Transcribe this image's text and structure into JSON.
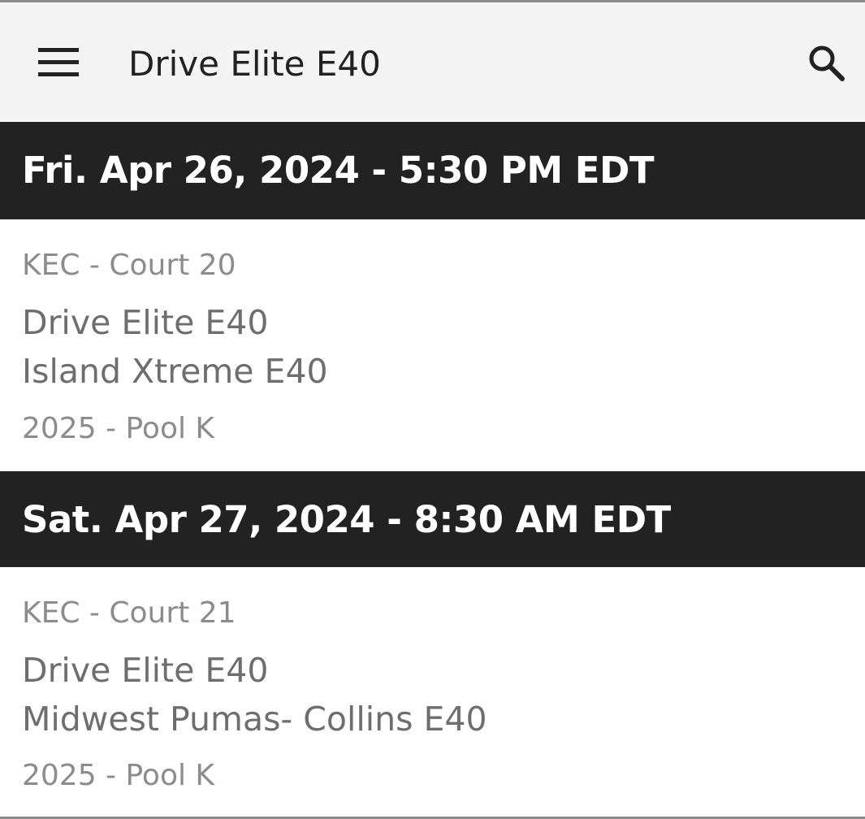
{
  "app_bar": {
    "title": "Drive Elite E40",
    "menu_icon": "hamburger-menu-icon",
    "search_icon": "search-icon"
  },
  "colors": {
    "app_bar_bg": "#f4f4f4",
    "date_header_bg": "#222222",
    "date_header_text": "#ffffff",
    "secondary_text": "#8c8c8c",
    "team_text": "#6e6e6e"
  },
  "schedule": [
    {
      "date": "Fri. Apr 26, 2024 - 5:30 PM EDT",
      "location": "KEC - Court 20",
      "team1": "Drive Elite E40",
      "team2": "Island Xtreme E40",
      "pool": "2025 - Pool K"
    },
    {
      "date": "Sat. Apr 27, 2024 - 8:30 AM EDT",
      "location": "KEC - Court 21",
      "team1": "Drive Elite E40",
      "team2": "Midwest Pumas- Collins E40",
      "pool": "2025 - Pool K"
    }
  ]
}
